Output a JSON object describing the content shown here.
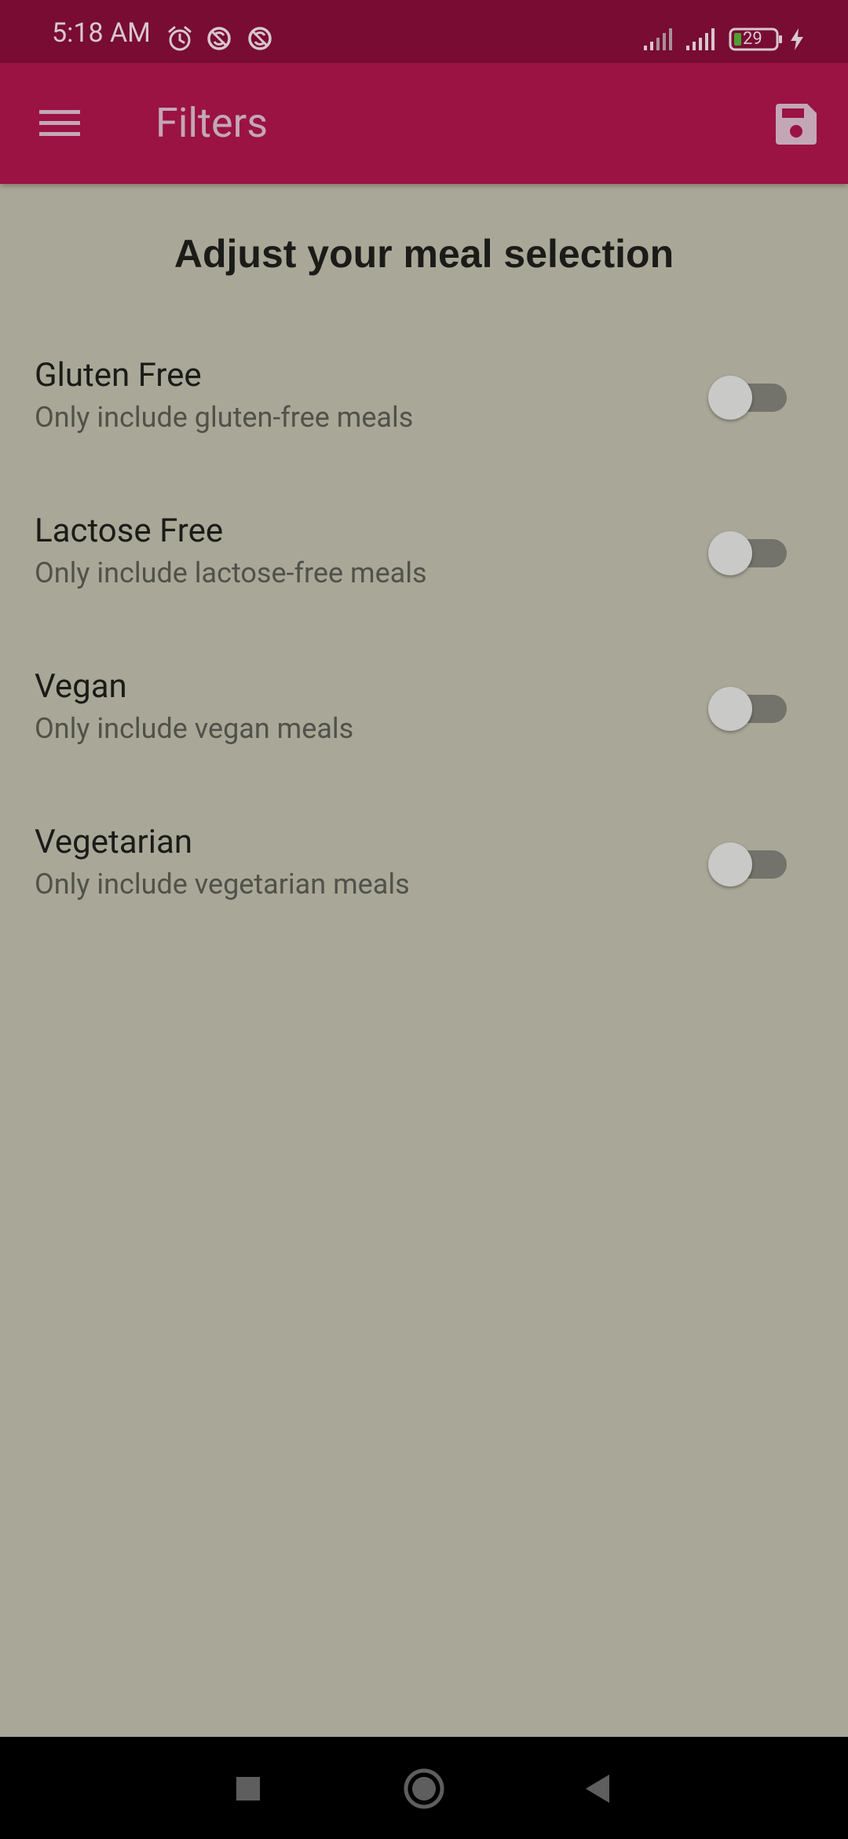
{
  "status_bar": {
    "time": "5:18 AM",
    "battery_level": "29",
    "icons": [
      "alarm-icon",
      "sync-disabled-icon",
      "sync-disabled-icon",
      "signal-icon",
      "signal-icon",
      "battery-icon",
      "charging-icon"
    ]
  },
  "app_bar": {
    "title": "Filters",
    "menu_icon": "hamburger-menu-icon",
    "save_icon": "save-icon"
  },
  "page": {
    "heading": "Adjust your meal selection"
  },
  "filters": [
    {
      "title": "Gluten Free",
      "subtitle": "Only include gluten-free meals",
      "enabled": false
    },
    {
      "title": "Lactose Free",
      "subtitle": "Only include lactose-free meals",
      "enabled": false
    },
    {
      "title": "Vegan",
      "subtitle": "Only include vegan meals",
      "enabled": false
    },
    {
      "title": "Vegetarian",
      "subtitle": "Only include vegetarian meals",
      "enabled": false
    }
  ],
  "nav_bar": {
    "icons": [
      "recents-square-icon",
      "home-circle-icon",
      "back-triangle-icon"
    ]
  },
  "colors": {
    "status_bar": "#780c33",
    "app_bar": "#9a1342",
    "background": "#a9a898",
    "nav_bar": "#000000"
  }
}
